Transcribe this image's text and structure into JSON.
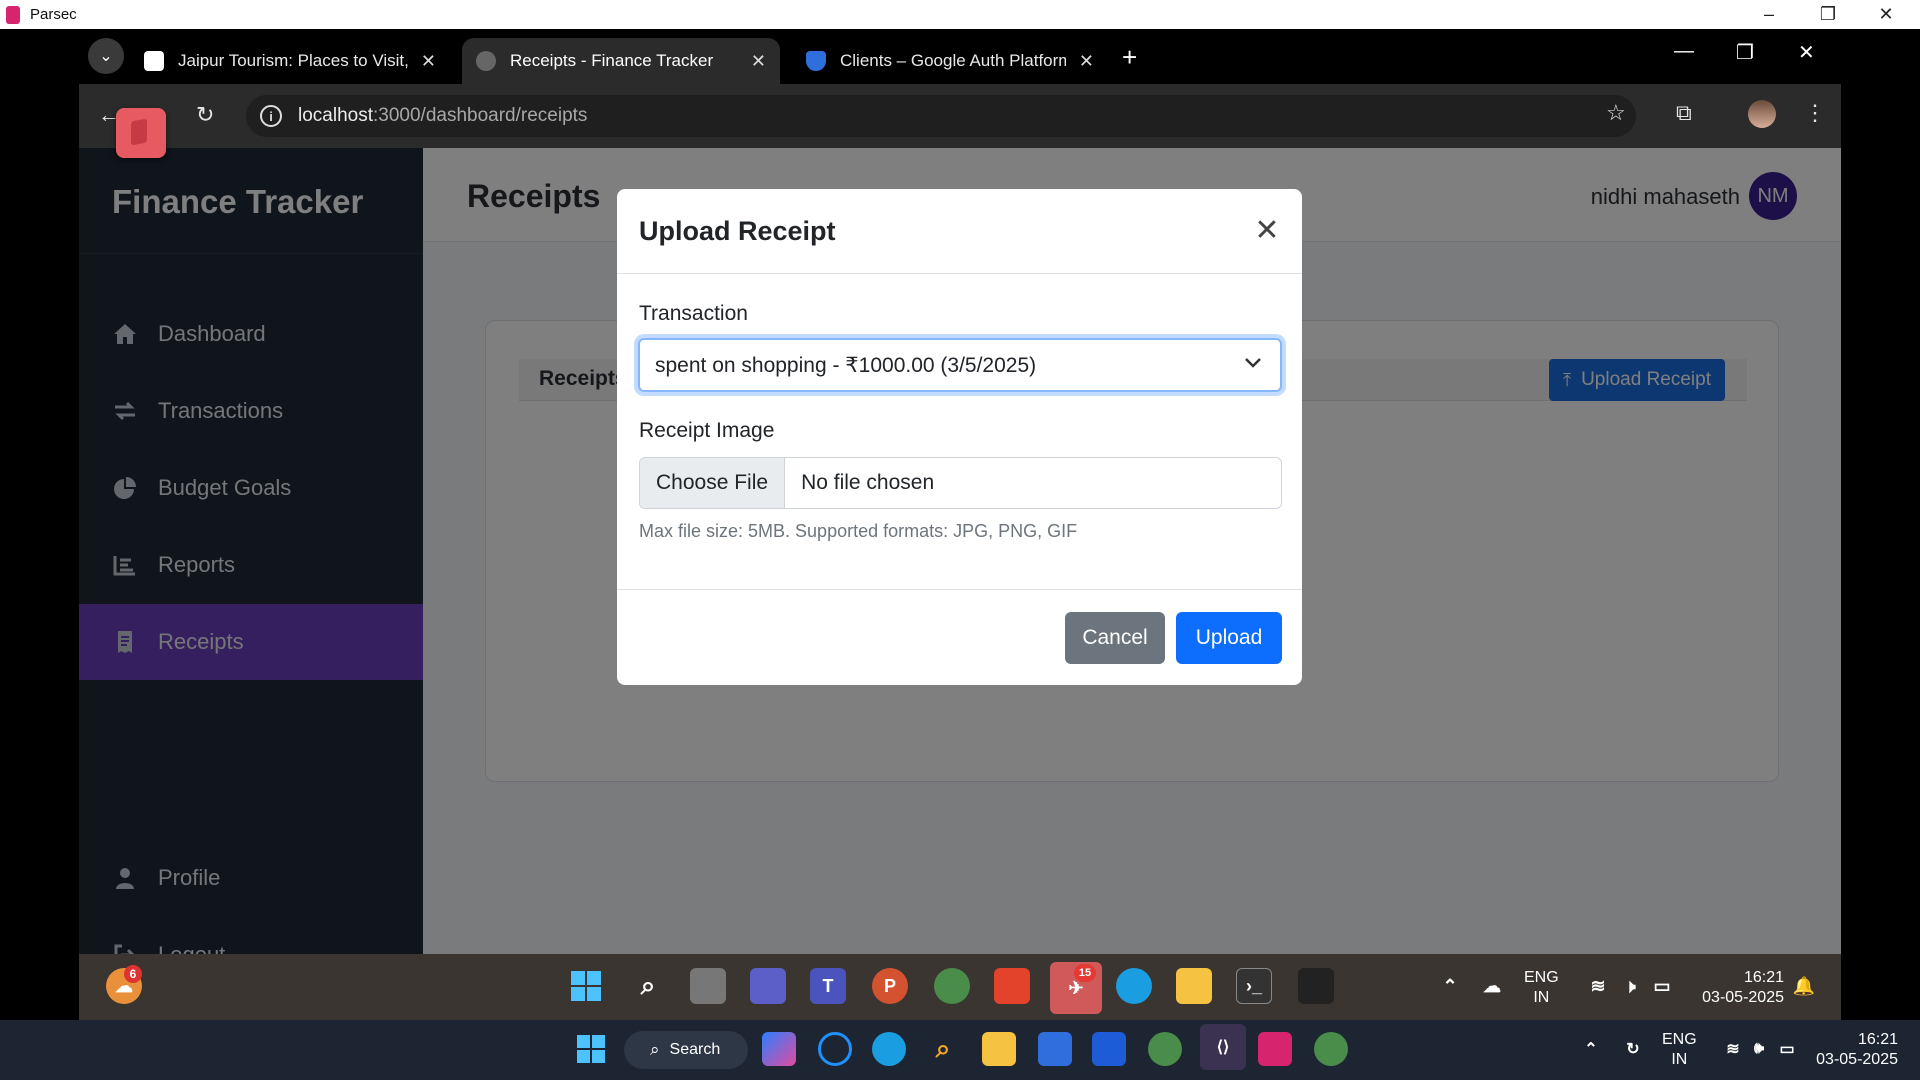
{
  "parsec": {
    "title": "Parsec"
  },
  "browser": {
    "tabs": [
      {
        "label": "Jaipur Tourism: Places to Visit, S",
        "active": false
      },
      {
        "label": "Receipts - Finance Tracker",
        "active": true
      },
      {
        "label": "Clients – Google Auth Platform",
        "active": false
      }
    ],
    "url_host": "localhost",
    "url_rest": ":3000/dashboard/receipts"
  },
  "sidebar": {
    "brand": "Finance Tracker",
    "items": [
      {
        "label": "Dashboard",
        "icon": "home-icon"
      },
      {
        "label": "Transactions",
        "icon": "exchange-icon"
      },
      {
        "label": "Budget Goals",
        "icon": "pie-chart-icon"
      },
      {
        "label": "Reports",
        "icon": "list-icon"
      },
      {
        "label": "Receipts",
        "icon": "receipt-icon",
        "active": true
      }
    ],
    "bottom_items": [
      {
        "label": "Profile",
        "icon": "user-icon"
      },
      {
        "label": "Logout",
        "icon": "logout-icon"
      }
    ]
  },
  "header": {
    "title": "Receipts",
    "user_name": "nidhi mahaseth",
    "user_initials": "NM"
  },
  "card": {
    "title": "Receipts",
    "upload_button": "Upload Receipt"
  },
  "modal": {
    "title": "Upload Receipt",
    "transaction_label": "Transaction",
    "transaction_selected": "spent on shopping - ₹1000.00 (3/5/2025)",
    "image_label": "Receipt Image",
    "choose_file": "Choose File",
    "file_status": "No file chosen",
    "help_text": "Max file size: 5MB. Supported formats: JPG, PNG, GIF",
    "cancel": "Cancel",
    "upload": "Upload"
  },
  "remote_taskbar": {
    "weather_badge": "6",
    "telegram_badge": "15",
    "lang_top": "ENG",
    "lang_bottom": "IN",
    "time": "16:21",
    "date": "03-05-2025"
  },
  "host_taskbar": {
    "search_label": "Search",
    "lang_top": "ENG",
    "lang_bottom": "IN",
    "time": "16:21",
    "date": "03-05-2025"
  },
  "colors": {
    "sidebar_bg": "#212936",
    "active_nav": "#6c3fbf",
    "primary": "#0d6efd",
    "secondary": "#6c757d"
  }
}
